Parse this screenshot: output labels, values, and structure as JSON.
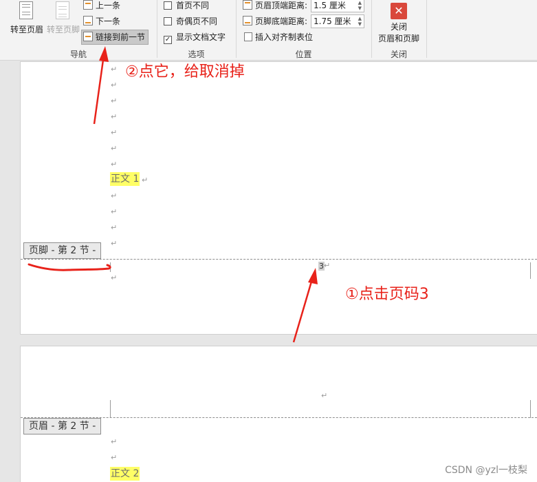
{
  "ribbon": {
    "nav": {
      "goto_header": "转至页眉",
      "goto_footer": "转至页脚",
      "previous": "上一条",
      "next": "下一条",
      "link_to_previous": "链接到前一节",
      "group_label": "导航"
    },
    "options": {
      "different_first_page": "首页不同",
      "different_odd_even": "奇偶页不同",
      "show_document_text": "显示文档文字",
      "show_document_text_checked": true,
      "group_label": "选项"
    },
    "position": {
      "header_from_top_label": "页眉顶端距离:",
      "header_from_top_value": "1.5 厘米",
      "footer_from_bottom_label": "页脚底端距离:",
      "footer_from_bottom_value": "1.75 厘米",
      "insert_alignment_tab": "插入对齐制表位",
      "group_label": "位置"
    },
    "close": {
      "label_line1": "关闭",
      "label_line2": "页眉和页脚",
      "group_label": "关闭"
    }
  },
  "document": {
    "paragraph_mark": "↵",
    "body_text_1": "正文 1",
    "body_text_2": "正文 2",
    "footer_tag": "页脚 - 第 2 节 -",
    "header_tag": "页眉 - 第 2 节 -",
    "page_number": "3"
  },
  "annotations": {
    "step2": "②点它，给取消掉",
    "step1": "①点击页码3",
    "color": "#e8221a"
  },
  "watermark": "CSDN @yzl一枝梨"
}
